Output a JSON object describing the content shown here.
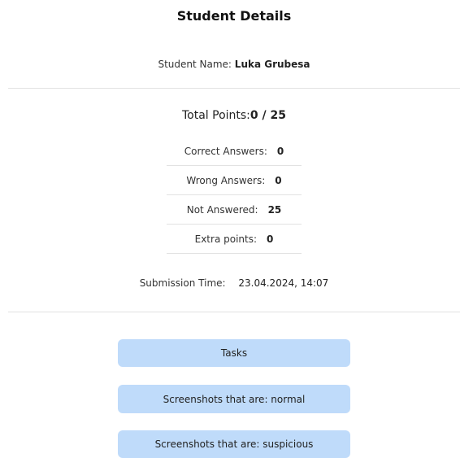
{
  "header": {
    "title": "Student Details"
  },
  "student": {
    "name_label": "Student Name:",
    "name_value": "Luka Grubesa"
  },
  "summary": {
    "total_label": "Total Points:",
    "total_value": "0 / 25",
    "stats": [
      {
        "label": "Correct Answers:",
        "value": "0"
      },
      {
        "label": "Wrong Answers:",
        "value": "0"
      },
      {
        "label": "Not Answered:",
        "value": "25"
      },
      {
        "label": "Extra points:",
        "value": "0"
      }
    ],
    "submission_label": "Submission Time:",
    "submission_value": "23.04.2024, 14:07"
  },
  "buttons": {
    "tasks": "Tasks",
    "screenshots_normal": "Screenshots that are: normal",
    "screenshots_suspicious": "Screenshots that are: suspicious"
  },
  "colors": {
    "button_bg": "#bfdbfa",
    "divider": "#e2e2e2"
  }
}
